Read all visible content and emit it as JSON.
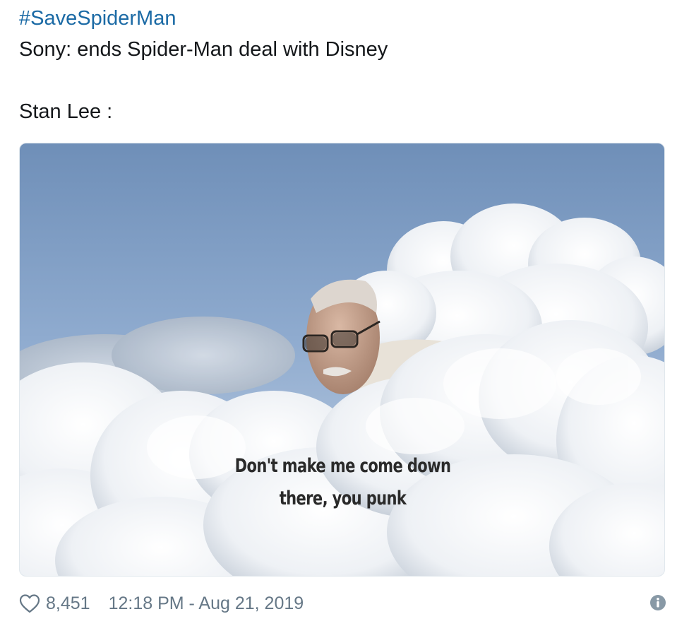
{
  "tweet": {
    "hashtag": "#SaveSpiderMan",
    "line1": "Sony: ends Spider-Man deal with Disney",
    "line2": "Stan Lee :"
  },
  "media": {
    "caption_line1": "Don't make me come down",
    "caption_line2": "there, you punk"
  },
  "footer": {
    "like_icon": "heart-icon",
    "like_count": "8,451",
    "timestamp": "12:18 PM - Aug 21, 2019",
    "info_icon": "info-icon"
  },
  "colors": {
    "hashtag": "#1b6aa5",
    "text": "#14171a",
    "meta": "#657786",
    "sky": "#7d9cc2"
  }
}
